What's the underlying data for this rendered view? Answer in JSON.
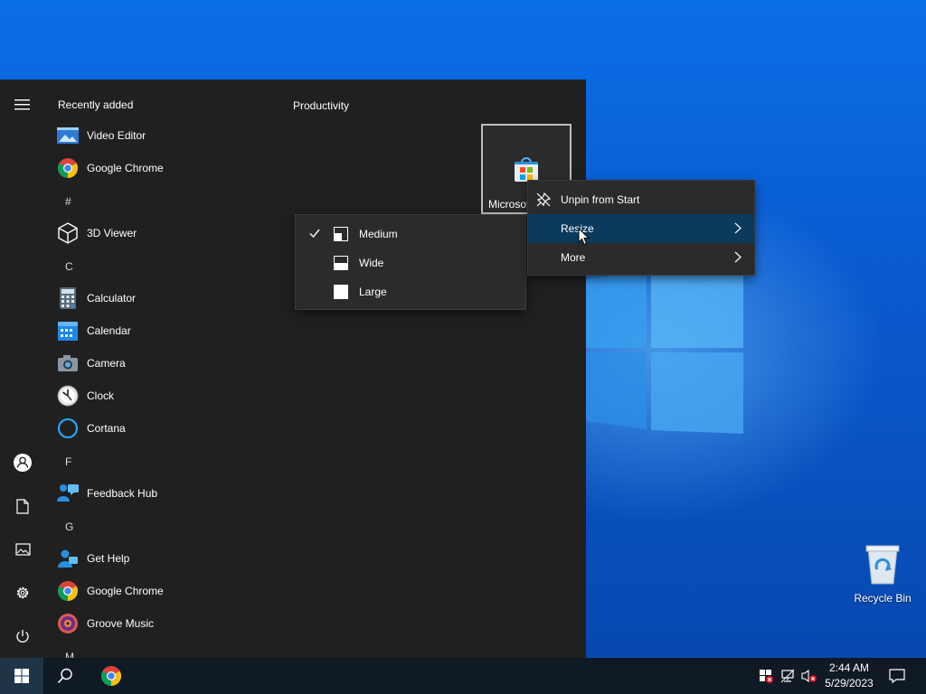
{
  "start_menu": {
    "recently_added_title": "Recently added",
    "group_title": "Productivity",
    "tile_label": "Microsoft Store",
    "apps": [
      {
        "kind": "app",
        "label": "Video Editor",
        "icon": "video-editor-icon"
      },
      {
        "kind": "app",
        "label": "Google Chrome",
        "icon": "chrome-icon"
      },
      {
        "kind": "letter",
        "label": "#"
      },
      {
        "kind": "app",
        "label": "3D Viewer",
        "icon": "3d-viewer-icon"
      },
      {
        "kind": "letter",
        "label": "C"
      },
      {
        "kind": "app",
        "label": "Calculator",
        "icon": "calculator-icon"
      },
      {
        "kind": "app",
        "label": "Calendar",
        "icon": "calendar-icon"
      },
      {
        "kind": "app",
        "label": "Camera",
        "icon": "camera-icon"
      },
      {
        "kind": "app",
        "label": "Clock",
        "icon": "clock-icon"
      },
      {
        "kind": "app",
        "label": "Cortana",
        "icon": "cortana-icon"
      },
      {
        "kind": "letter",
        "label": "F"
      },
      {
        "kind": "app",
        "label": "Feedback Hub",
        "icon": "feedback-hub-icon"
      },
      {
        "kind": "letter",
        "label": "G"
      },
      {
        "kind": "app",
        "label": "Get Help",
        "icon": "get-help-icon"
      },
      {
        "kind": "app",
        "label": "Google Chrome",
        "icon": "chrome-icon"
      },
      {
        "kind": "app",
        "label": "Groove Music",
        "icon": "groove-music-icon"
      },
      {
        "kind": "letter",
        "label": "M"
      }
    ]
  },
  "context_menu": {
    "items": [
      {
        "label": "Unpin from Start",
        "icon": "unpin-icon"
      },
      {
        "label": "Resize",
        "has_submenu": true
      },
      {
        "label": "More",
        "has_submenu": true
      }
    ]
  },
  "resize_submenu": {
    "items": [
      {
        "label": "Medium",
        "checked": true
      },
      {
        "label": "Wide",
        "checked": false
      },
      {
        "label": "Large",
        "checked": false
      }
    ]
  },
  "desktop": {
    "recycle_bin_label": "Recycle Bin"
  },
  "taskbar": {
    "time": "2:44 AM",
    "date": "5/29/2023"
  },
  "colors": {
    "start_bg": "#202020",
    "menu_bg": "#2b2b2b",
    "highlight": "#0b3a5c",
    "accent": "#0078d7"
  }
}
